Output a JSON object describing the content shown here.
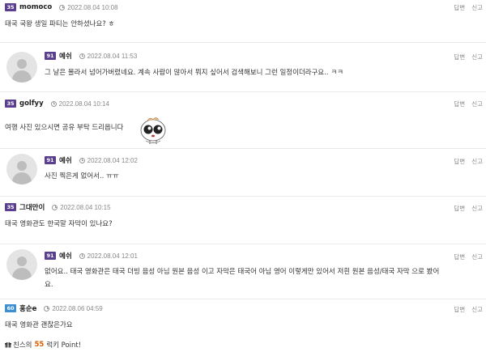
{
  "actions": {
    "reply": "답변",
    "report": "신고"
  },
  "comments": [
    {
      "level": "35",
      "nick": "momoco",
      "date": "2022.08.04 10:08",
      "text": "태국 국왕 생일 파티는 안하셨나요? ㅎ"
    },
    {
      "level": "91",
      "nick": "예쉬",
      "date": "2022.08.04 11:53",
      "text": "그 날은 몰라서 넘어가버렸네요. 계속 사람이 많아서 뭐지 싶어서 검색해보니 그런 일정이더라구요.. ㅋㅋ"
    },
    {
      "level": "35",
      "nick": "golfyy",
      "date": "2022.08.04 10:14",
      "text": "여행 사진 있으시면 공유 부탁 드리옵니다"
    },
    {
      "level": "91",
      "nick": "예쉬",
      "date": "2022.08.04 12:02",
      "text": "사진 찍은게 없어서.. ㅠㅠ"
    },
    {
      "level": "35",
      "nick": "그대만이",
      "date": "2022.08.04 10:15",
      "text": "태국 영화관도 한국말 자막이 있나요?"
    },
    {
      "level": "91",
      "nick": "예쉬",
      "date": "2022.08.04 12:01",
      "text_line1": "없어요.. 태국 영화관은 태국 더빙 음성 아님 원본 음성 이고 자막은 태국어 아님 영어 이렇게만 있어서 저흰 원본 음성/태국 자막 으로 봤어",
      "text_line2": "요."
    },
    {
      "level": "60",
      "nick": "홍순e",
      "date": "2022.08.06 04:59",
      "text": "태국 영화관 괜찮은가요"
    }
  ],
  "footer": {
    "prefix": "친스의",
    "points": "55",
    "suffix": "럭키 Point!"
  },
  "colors": {
    "level_purple": "#5a3f8f",
    "level_blue": "#3d8fd1",
    "points": "#e05a00"
  }
}
